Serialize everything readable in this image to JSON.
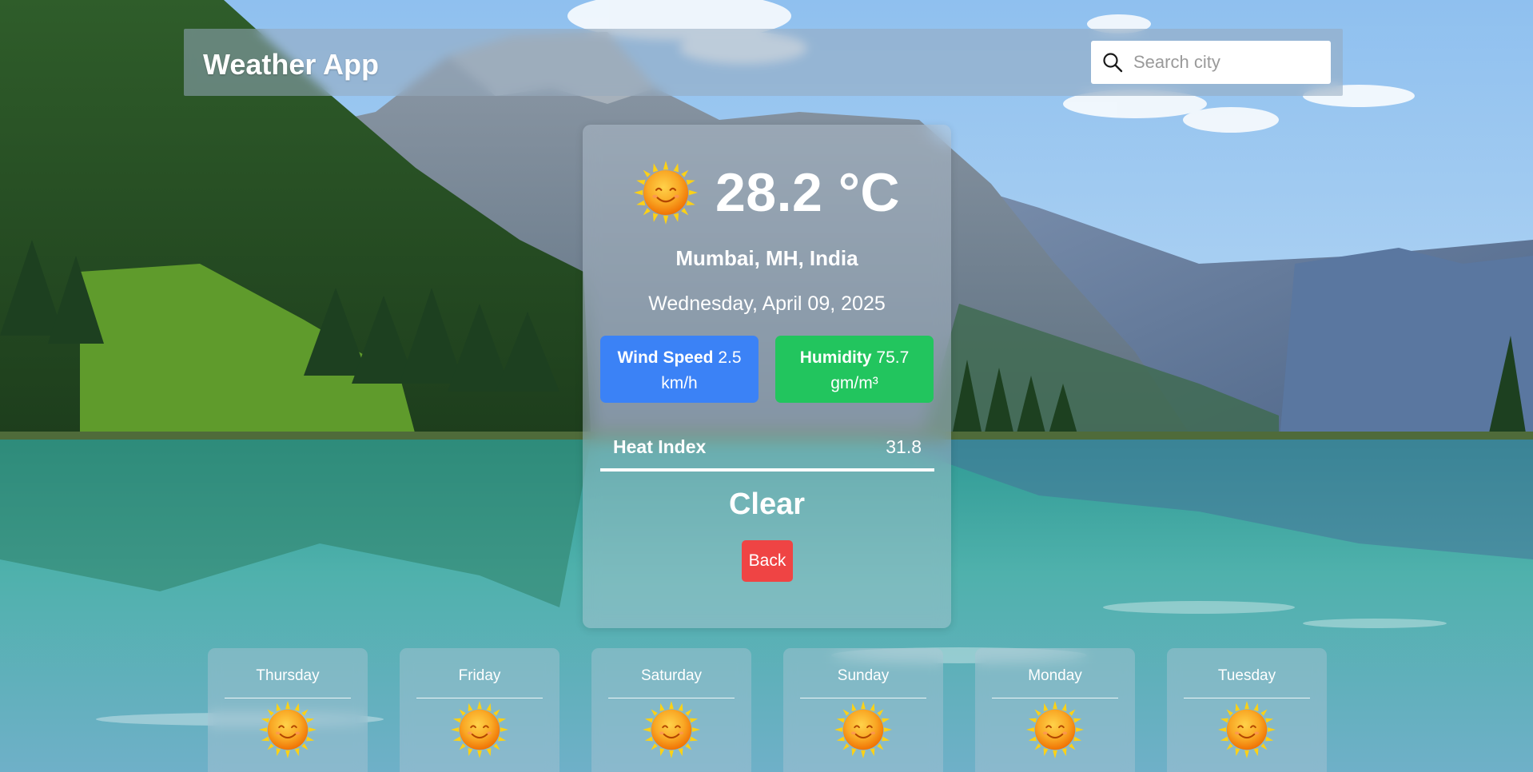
{
  "header": {
    "title": "Weather App",
    "search": {
      "placeholder": "Search city",
      "value": ""
    }
  },
  "current": {
    "temperature": "28.2 °C",
    "location": "Mumbai, MH, India",
    "date": "Wednesday, April 09, 2025",
    "wind_speed": {
      "label": "Wind Speed",
      "value": "2.5",
      "unit": "km/h"
    },
    "humidity": {
      "label": "Humidity",
      "value": "75.7",
      "unit": "gm/m³"
    },
    "heat_index": {
      "label": "Heat Index",
      "value": "31.8"
    },
    "condition": "Clear",
    "back_label": "Back",
    "icon": "sun-icon"
  },
  "forecast": [
    {
      "day": "Thursday",
      "icon": "sun-icon"
    },
    {
      "day": "Friday",
      "icon": "sun-icon"
    },
    {
      "day": "Saturday",
      "icon": "sun-icon"
    },
    {
      "day": "Sunday",
      "icon": "sun-icon"
    },
    {
      "day": "Monday",
      "icon": "sun-icon"
    },
    {
      "day": "Tuesday",
      "icon": "sun-icon"
    }
  ],
  "colors": {
    "wind_badge": "#3b82f6",
    "humidity_badge": "#22c55e",
    "back_button": "#ef4444"
  }
}
